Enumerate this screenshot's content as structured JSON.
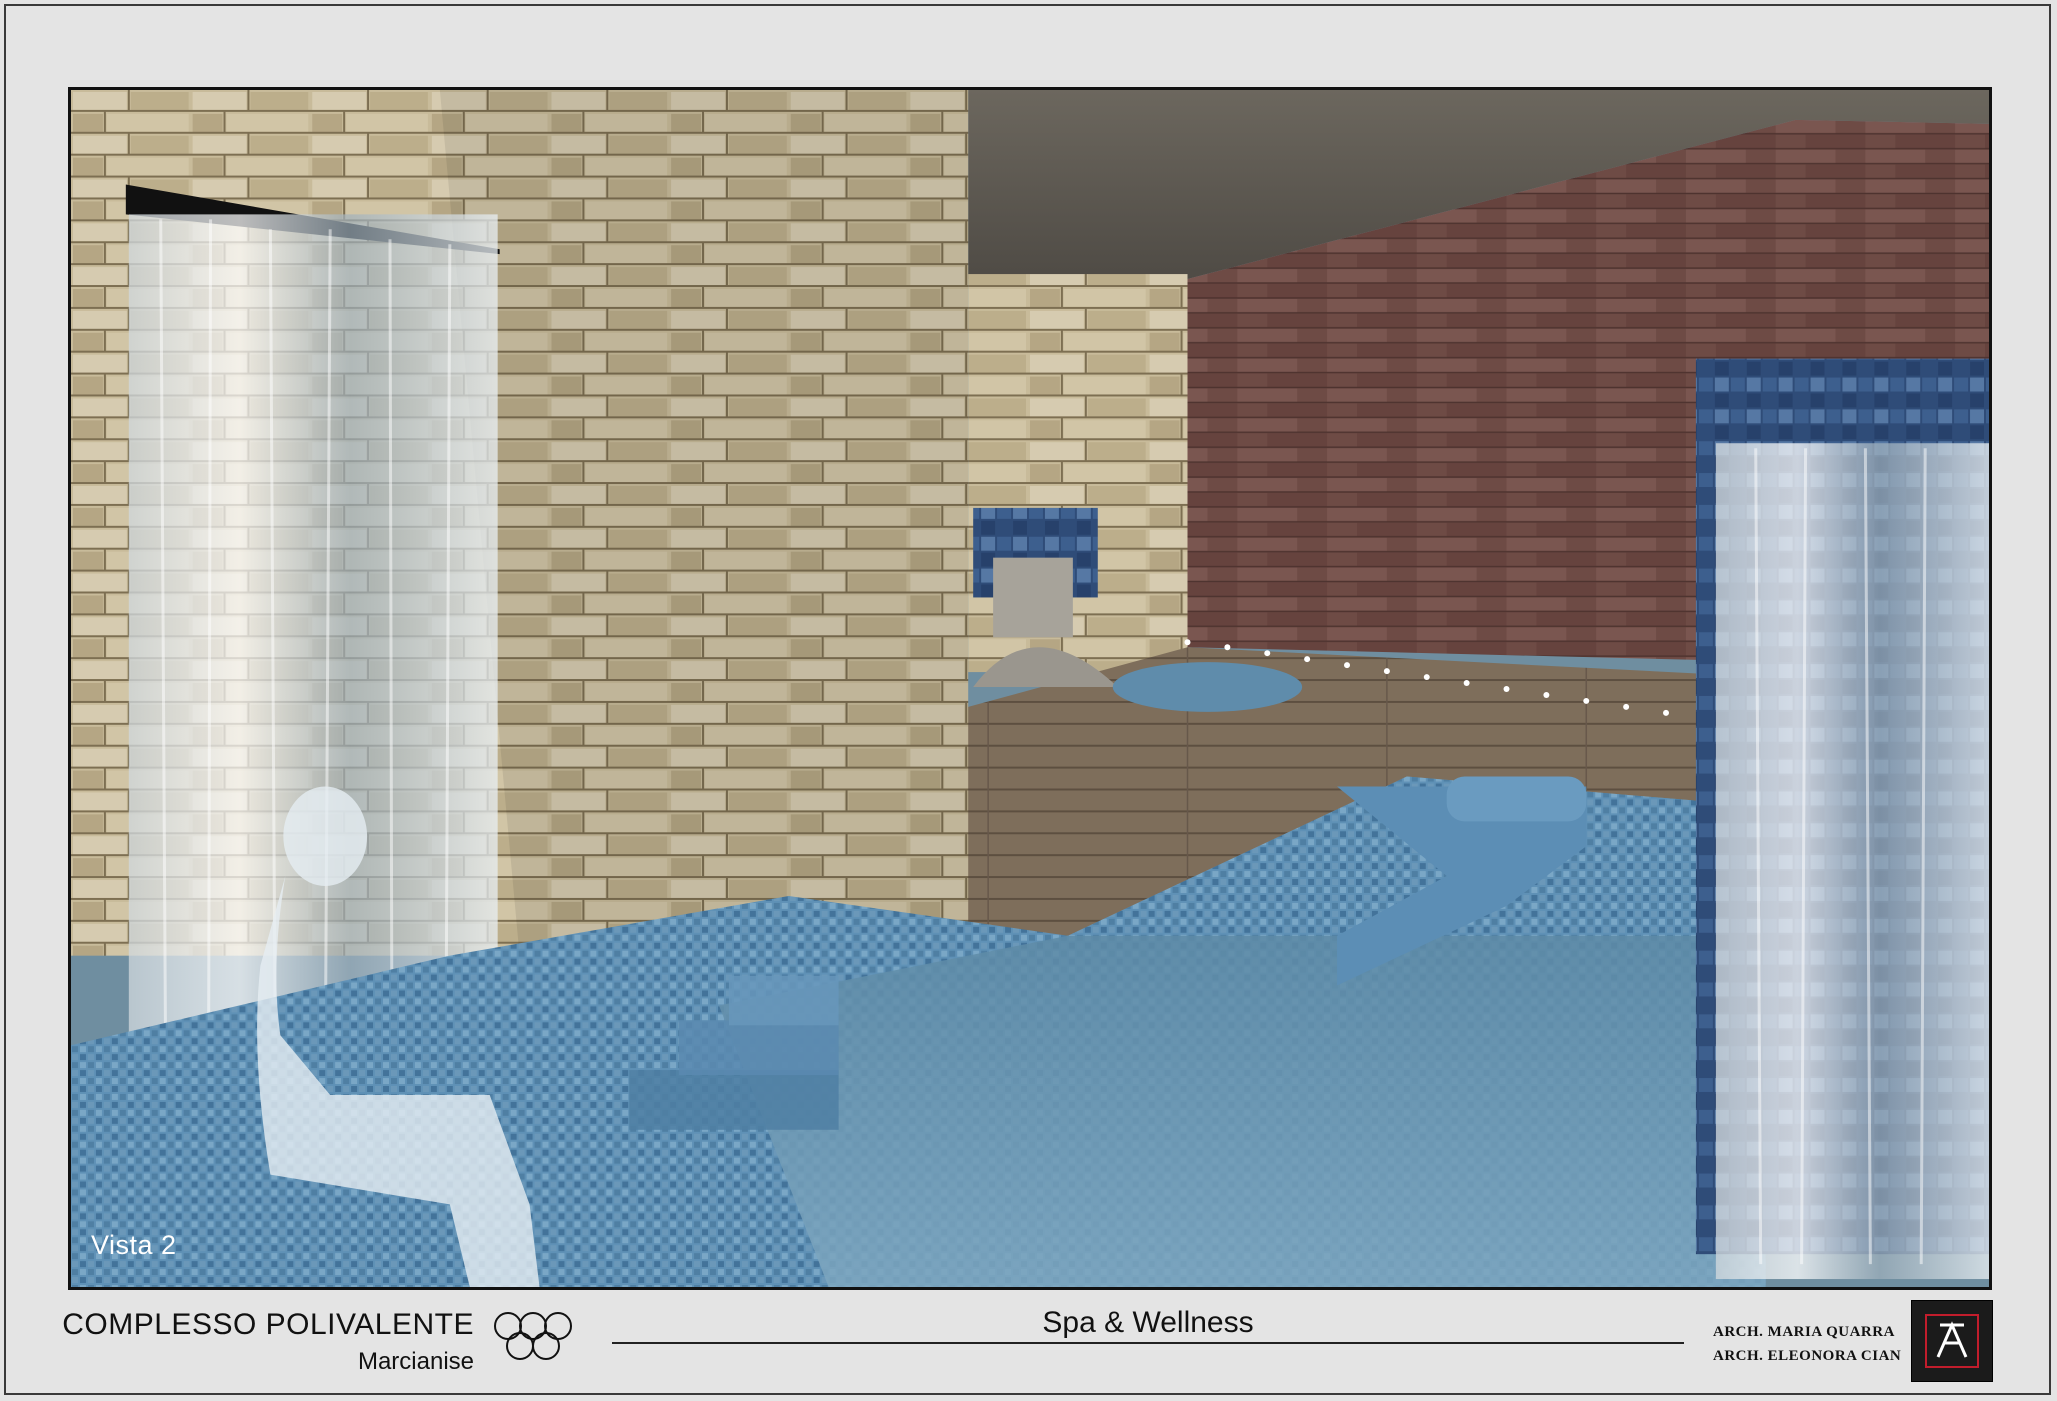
{
  "render": {
    "view_label": "Vista 2",
    "palette": {
      "stone": "#c9bc9c",
      "wood_wall": "#6e4a44",
      "deck": "#7b6b58",
      "water": "#6b93ad",
      "mosaic": "#4a7fa6",
      "ceiling": "#5f5a52"
    }
  },
  "title_block": {
    "project_name": "COMPLESSO POLIVALENTE",
    "project_city": "Marcianise",
    "sheet_title": "Spa & Wellness",
    "architects": [
      "ARCH. MARIA QUARRA",
      "ARCH. ELEONORA CIAN"
    ],
    "rings_icon": "olympic-rings-icon",
    "studio_icon": "studio-logo-icon"
  }
}
